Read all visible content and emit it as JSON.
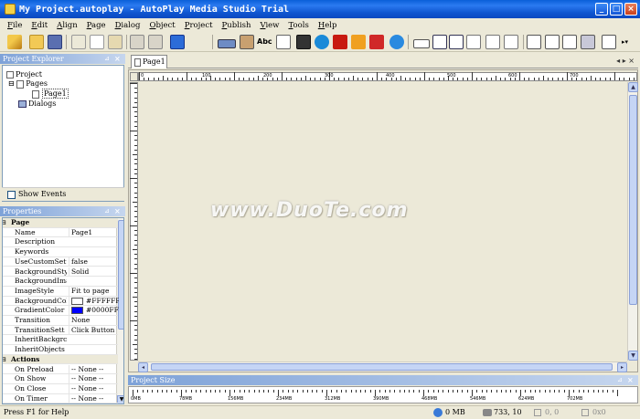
{
  "window": {
    "title": "My Project.autoplay - AutoPlay Media Studio Trial"
  },
  "menu": [
    "File",
    "Edit",
    "Align",
    "Page",
    "Dialog",
    "Object",
    "Project",
    "Publish",
    "View",
    "Tools",
    "Help"
  ],
  "project_explorer": {
    "title": "Project Explorer",
    "tree": {
      "root": "Project",
      "pages": "Pages",
      "page1": "Page1",
      "dialogs": "Dialogs"
    },
    "show_events": "Show Events"
  },
  "properties": {
    "title": "Properties",
    "rows": [
      {
        "cat": true,
        "key": "Page"
      },
      {
        "key": "Name",
        "value": "Page1"
      },
      {
        "key": "Description",
        "value": ""
      },
      {
        "key": "Keywords",
        "value": ""
      },
      {
        "key": "UseCustomSetti",
        "value": "false"
      },
      {
        "key": "BackgroundStyl",
        "value": "Solid"
      },
      {
        "key": "BackgroundImag",
        "value": ""
      },
      {
        "key": "ImageStyle",
        "value": "Fit to page"
      },
      {
        "key": "BackgroundColo",
        "value": "#FFFFFF",
        "swatch": "#ffffff"
      },
      {
        "key": "GradientColor",
        "value": "#0000FF",
        "swatch": "#0000ff"
      },
      {
        "key": "Transition",
        "value": "None"
      },
      {
        "key": "TransitionSett",
        "value": "Click Button"
      },
      {
        "key": "InheritBackgrc",
        "value": ""
      },
      {
        "key": "InheritObjects",
        "value": ""
      },
      {
        "cat": true,
        "key": "Actions"
      },
      {
        "key": "On Preload",
        "value": "-- None --"
      },
      {
        "key": "On Show",
        "value": "-- None --"
      },
      {
        "key": "On Close",
        "value": "-- None --"
      },
      {
        "key": "On Timer",
        "value": "-- None --"
      }
    ]
  },
  "tab": {
    "label": "Page1"
  },
  "ruler_labels": [
    "0",
    "100",
    "200",
    "300",
    "400",
    "500",
    "600",
    "700"
  ],
  "project_size": {
    "title": "Project Size",
    "labels": [
      "0MB",
      "78MB",
      "156MB",
      "234MB",
      "312MB",
      "390MB",
      "468MB",
      "546MB",
      "624MB",
      "702MB"
    ]
  },
  "watermark": "www.DuoTe.com",
  "status": {
    "help": "Press F1 for Help",
    "size": "0 MB",
    "coords": "733, 10",
    "pos": "0, 0",
    "dim": "0x0"
  }
}
